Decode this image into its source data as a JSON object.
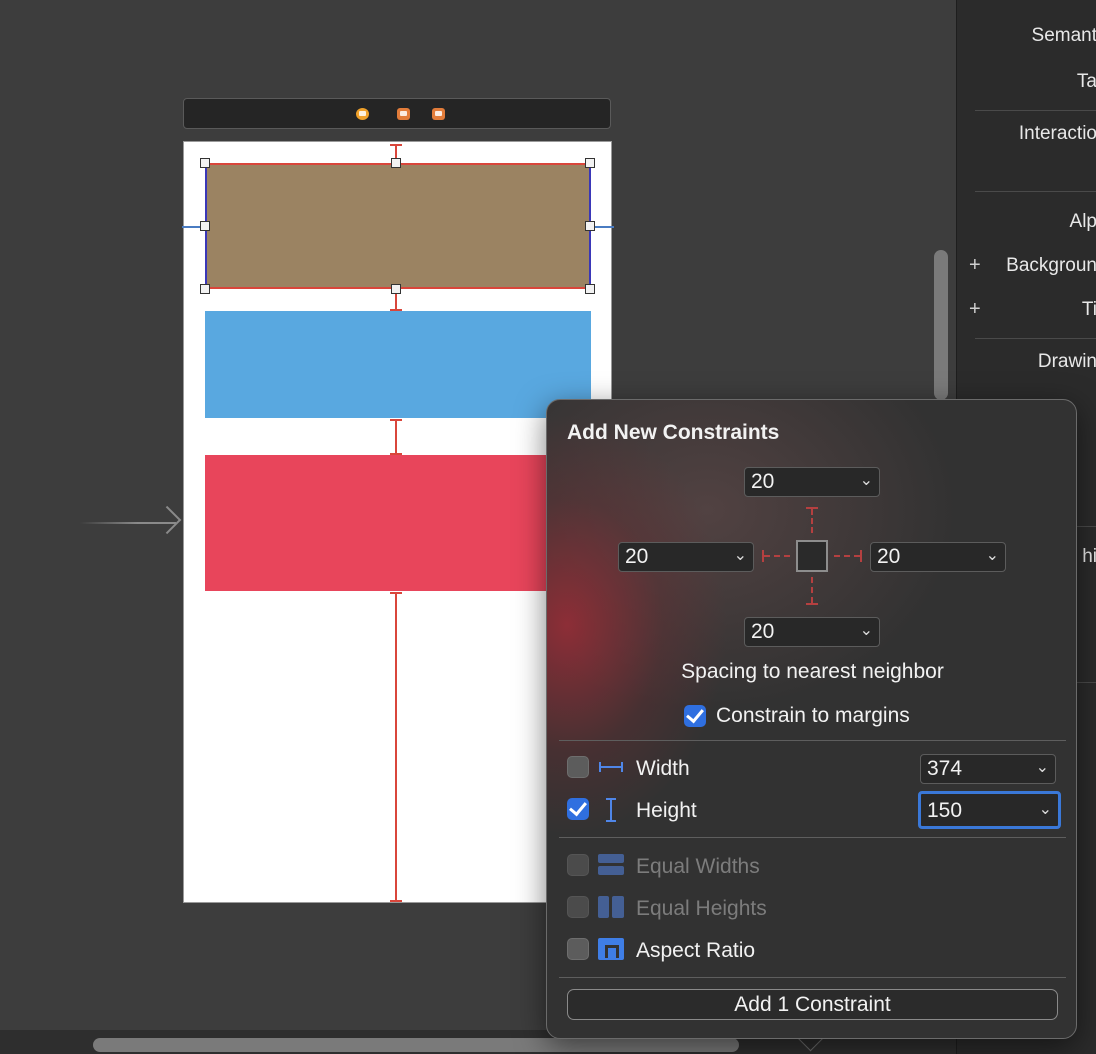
{
  "inspector": {
    "labels": [
      "Semant",
      "Ta",
      "Interactio",
      "Alp",
      "Backgroun",
      "Ti",
      "Drawin",
      "hi"
    ]
  },
  "popover": {
    "title": "Add New Constraints",
    "spacing": {
      "top": "20",
      "left": "20",
      "right": "20",
      "bottom": "20"
    },
    "spacing_label": "Spacing to nearest neighbor",
    "constrain_to_margins": {
      "label": "Constrain to margins",
      "checked": true
    },
    "rows": [
      {
        "label": "Width",
        "value": "374",
        "checked": false,
        "enabled": true
      },
      {
        "label": "Height",
        "value": "150",
        "checked": true,
        "enabled": true
      },
      {
        "label": "Equal Widths",
        "checked": false,
        "enabled": false
      },
      {
        "label": "Equal Heights",
        "checked": false,
        "enabled": false
      },
      {
        "label": "Aspect Ratio",
        "checked": false,
        "enabled": true
      }
    ],
    "add_button": "Add 1 Constraint"
  },
  "colors": {
    "view_brown": "#9b8362",
    "view_blue": "#59a8e0",
    "view_red": "#e8455b",
    "accent": "#2f6fe0",
    "constraint": "#d9463b"
  },
  "icons": {
    "scene": [
      "view-controller-icon",
      "first-responder-icon",
      "exit-icon"
    ],
    "width": "width-constraint-icon",
    "height": "height-constraint-icon",
    "equal_widths": "equal-widths-icon",
    "equal_heights": "equal-heights-icon",
    "aspect_ratio": "aspect-ratio-icon"
  }
}
